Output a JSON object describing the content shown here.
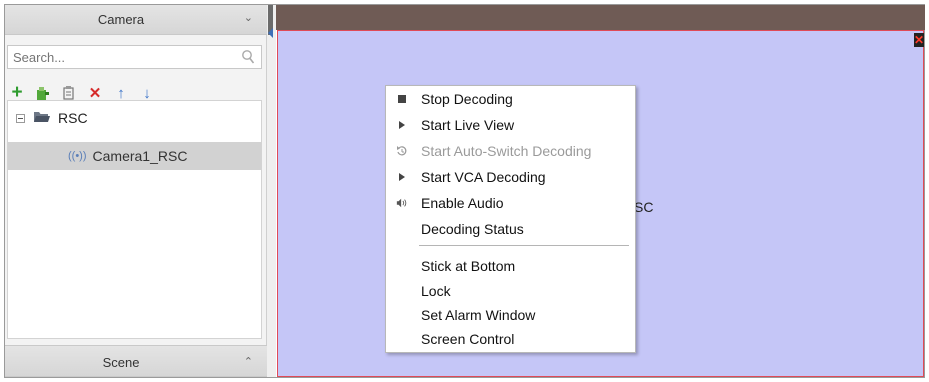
{
  "left_panel": {
    "camera_header": "Camera",
    "search_placeholder": "Search...",
    "tree": {
      "root_label": "RSC",
      "camera_label": "Camera1_RSC",
      "camera_icon_glyph": "((•))"
    },
    "scene_header": "Scene",
    "chevrons": {
      "collapse": "⌄",
      "expand": "⌃"
    }
  },
  "toolbar": {
    "icons": [
      "add-icon",
      "import-icon",
      "remark-icon",
      "delete-icon",
      "move-up-icon",
      "move-down-icon"
    ],
    "glyphs": {
      "add": "+",
      "delete": "✕",
      "up": "↑",
      "down": "↓"
    },
    "colors": {
      "add": "#2e9b2e",
      "delete": "#d62b2b",
      "arrows": "#3b73c8"
    }
  },
  "video_pane": {
    "label_fragment": "SC",
    "close_glyph": "✕",
    "background": "#c5c6f7",
    "border": "#e04a57"
  },
  "context_menu": {
    "items": [
      {
        "label": "Stop Decoding",
        "icon": "stop-icon",
        "enabled": true
      },
      {
        "label": "Start Live View",
        "icon": "play-icon",
        "enabled": true
      },
      {
        "label": "Start Auto-Switch Decoding",
        "icon": "auto-switch-icon",
        "enabled": false
      },
      {
        "label": "Start VCA Decoding",
        "icon": "play-icon",
        "enabled": true
      },
      {
        "label": "Enable Audio",
        "icon": "speaker-icon",
        "enabled": true
      },
      {
        "label": "Decoding Status",
        "icon": "",
        "enabled": true
      },
      {
        "label": "Stick at Bottom",
        "icon": "",
        "enabled": true
      },
      {
        "label": "Lock",
        "icon": "",
        "enabled": true
      },
      {
        "label": "Set Alarm Window",
        "icon": "",
        "enabled": true
      },
      {
        "label": "Screen Control",
        "icon": "",
        "enabled": true
      }
    ]
  }
}
